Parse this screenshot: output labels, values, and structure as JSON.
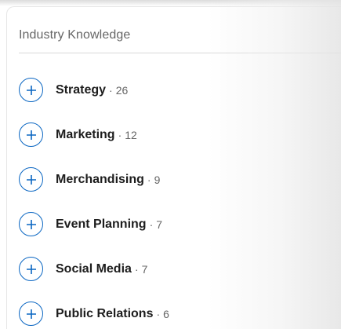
{
  "section": {
    "title": "Industry Knowledge"
  },
  "separator": "·",
  "skills": [
    {
      "name": "Strategy",
      "count": "26"
    },
    {
      "name": "Marketing",
      "count": "12"
    },
    {
      "name": "Merchandising",
      "count": "9"
    },
    {
      "name": "Event Planning",
      "count": "7"
    },
    {
      "name": "Social Media",
      "count": "7"
    },
    {
      "name": "Public Relations",
      "count": "6"
    }
  ],
  "colors": {
    "accent": "#0a66c2",
    "text": "#1d1d1d",
    "muted": "#666666"
  },
  "icons": {
    "add": "plus-circle-icon"
  }
}
